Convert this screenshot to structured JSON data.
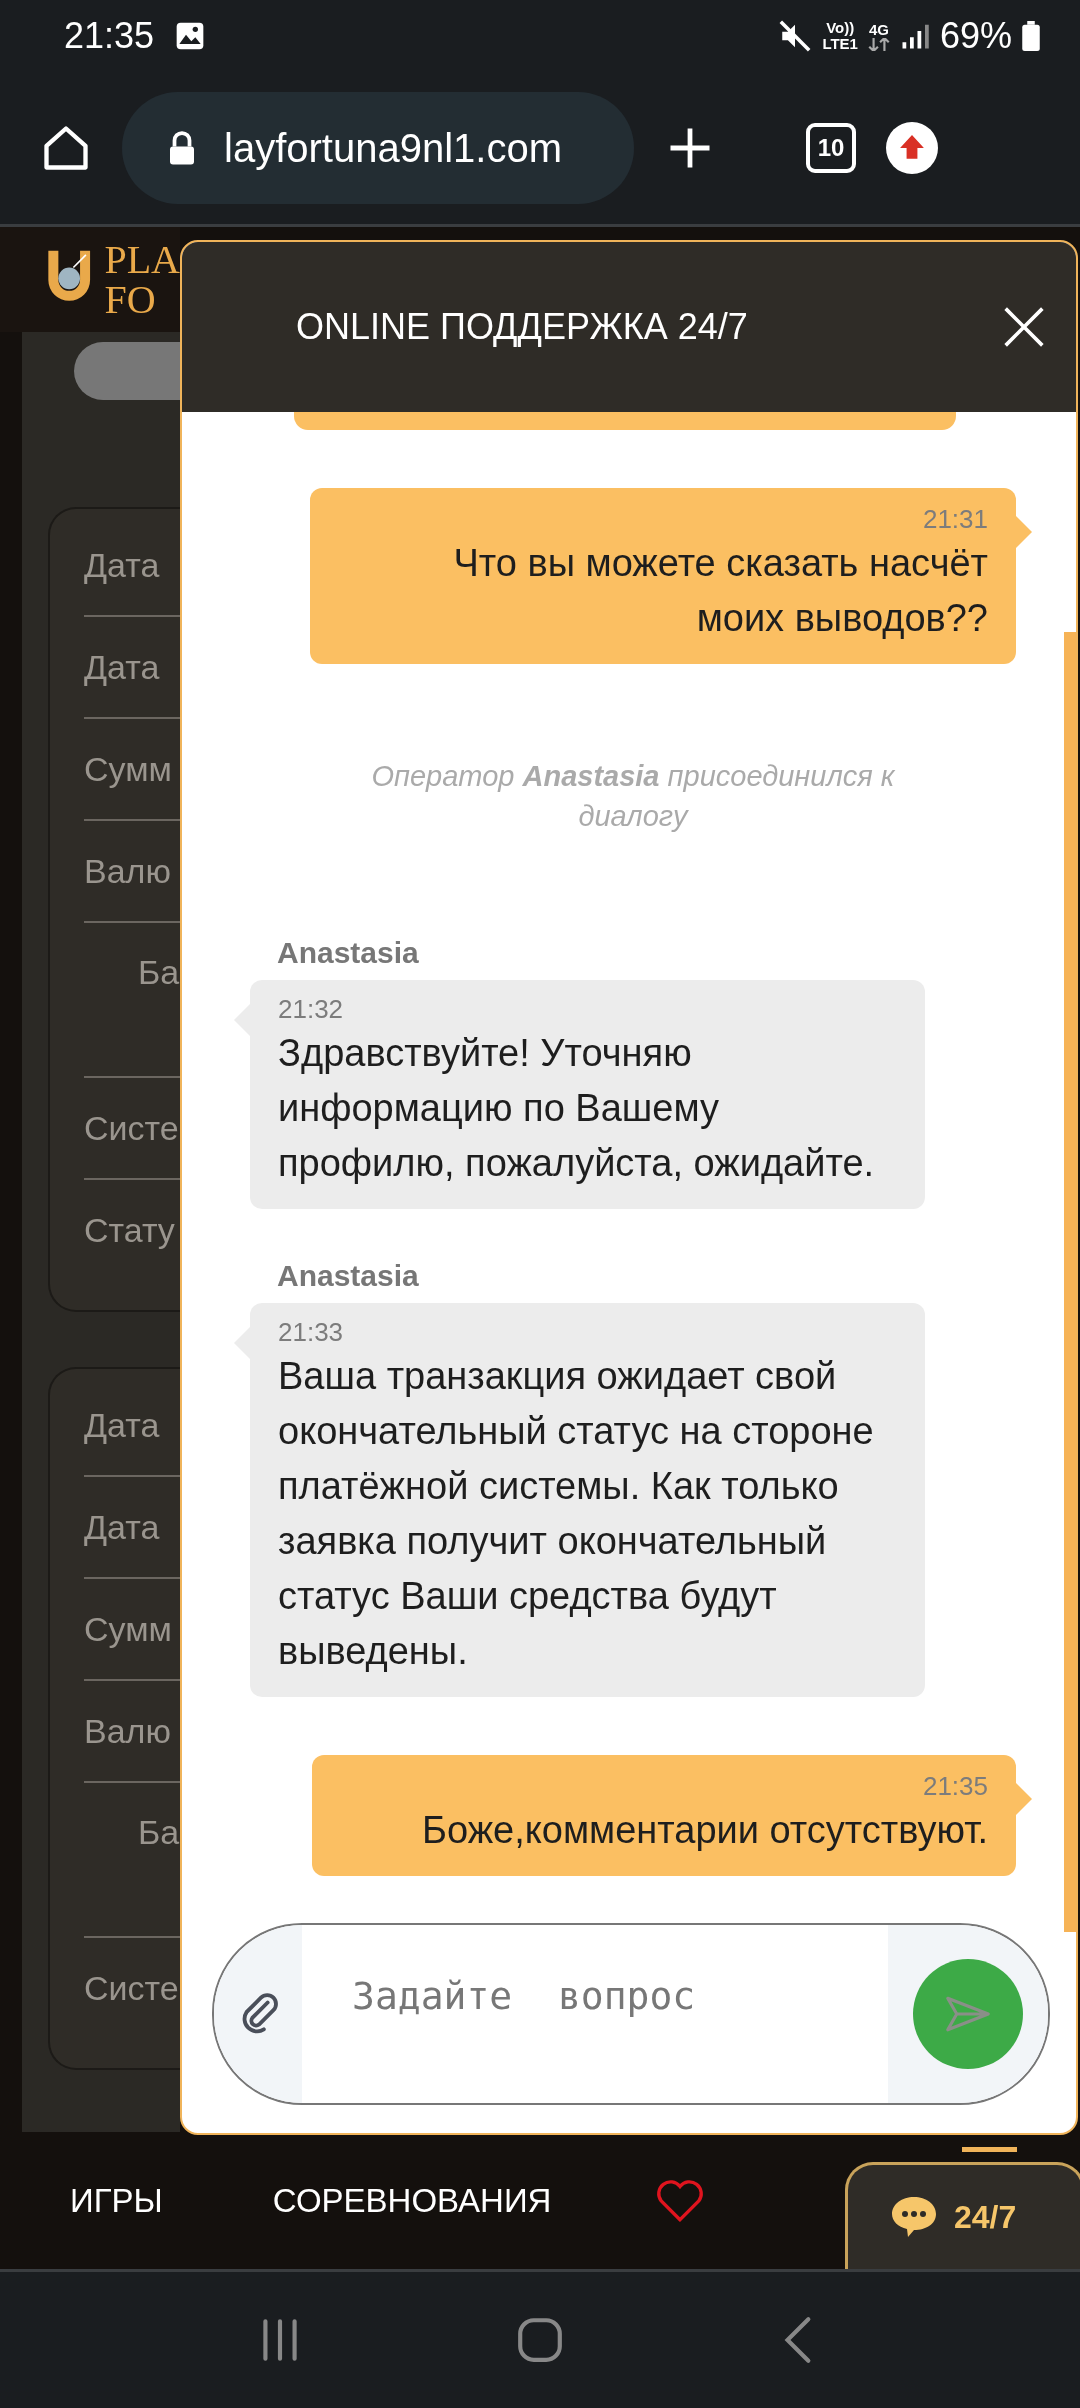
{
  "status_bar": {
    "time": "21:35",
    "volte": "Vo))",
    "lte": "LTE1",
    "network_type": "4G",
    "battery": "69%"
  },
  "browser": {
    "url": "layfortuna9nl1.com",
    "tab_count": "10"
  },
  "site": {
    "logo_lines": [
      "PLA",
      "FO"
    ],
    "cards": [
      {
        "rows": [
          {
            "label": "Дата",
            "kind": "field"
          },
          {
            "label": "Дата",
            "kind": "field"
          },
          {
            "label": "Сумм",
            "kind": "field"
          },
          {
            "label": "Валю",
            "kind": "field"
          },
          {
            "label": "Ба",
            "kind": "sub"
          },
          {
            "label": "Систе",
            "kind": "field"
          },
          {
            "label": "Стату",
            "kind": "field"
          }
        ]
      },
      {
        "rows": [
          {
            "label": "Дата",
            "kind": "field"
          },
          {
            "label": "Дата",
            "kind": "field"
          },
          {
            "label": "Сумм",
            "kind": "field"
          },
          {
            "label": "Валю",
            "kind": "field"
          },
          {
            "label": "Ба",
            "kind": "sub"
          },
          {
            "label": "Систе",
            "kind": "field"
          }
        ]
      }
    ]
  },
  "chat": {
    "title": "ONLINE ПОДДЕРЖКА 24/7",
    "messages": [
      {
        "kind": "user",
        "time": "21:31",
        "text": "Что вы можете сказать насчёт моих выводов??"
      },
      {
        "kind": "system",
        "text": "Оператор **Anastasia** присоединился к диалогу"
      },
      {
        "kind": "operator",
        "author": "Anastasia",
        "time": "21:32",
        "text": "Здравствуйте! Уточняю информацию по Вашему профилю, пожалуйста, ожидайте."
      },
      {
        "kind": "operator",
        "author": "Anastasia",
        "time": "21:33",
        "text": "Ваша транзакция ожидает свой окончательный статус на стороне платёжной системы. Как только заявка получит окончательный статус Ваши средства будут выведены."
      },
      {
        "kind": "user",
        "time": "21:35",
        "text": "Боже,комментарии отсутствуют."
      }
    ],
    "input": {
      "placeholder": "Задайте  вопрос"
    }
  },
  "bottom_nav": {
    "items": [
      {
        "label": "ИГРЫ"
      },
      {
        "label": "СОРЕВНОВАНИЯ"
      }
    ],
    "chat_button": "24/7"
  }
}
